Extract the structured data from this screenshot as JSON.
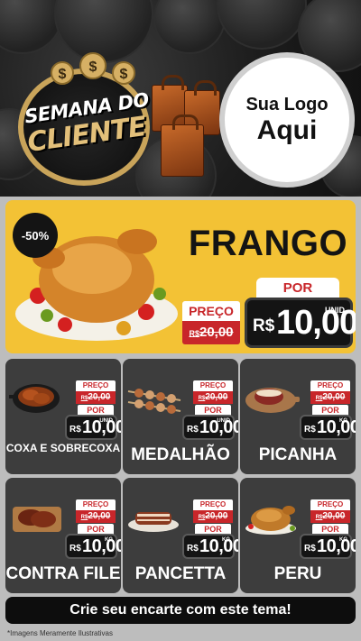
{
  "header": {
    "badge_line1": "SEMANA DO",
    "badge_line2": "CLIENTE",
    "logo_line1": "Sua Logo",
    "logo_line2": "Aqui"
  },
  "main_product": {
    "discount": "-50%",
    "name": "FRANGO",
    "price_label": "PREÇO",
    "old_currency": "R$",
    "old_price": "20,00",
    "por_label": "POR",
    "currency": "R$",
    "new_price": "10,00",
    "unit": "UNID",
    "image_icon": "roast-chicken-icon"
  },
  "products": [
    {
      "name": "COXA E SOBRECOXA",
      "price_label": "PREÇO",
      "old_currency": "R$",
      "old_price": "20,00",
      "por_label": "POR",
      "currency": "R$",
      "new_price": "10,00",
      "unit": "UNID",
      "image_icon": "chicken-thigh-pan-icon"
    },
    {
      "name": "MEDALHÃO",
      "price_label": "PREÇO",
      "old_currency": "R$",
      "old_price": "20,00",
      "por_label": "POR",
      "currency": "R$",
      "new_price": "10,00",
      "unit": "UNID",
      "image_icon": "skewers-icon"
    },
    {
      "name": "PICANHA",
      "price_label": "PREÇO",
      "old_currency": "R$",
      "old_price": "20,00",
      "por_label": "POR",
      "currency": "R$",
      "new_price": "10,00",
      "unit": "KG",
      "image_icon": "picanha-board-icon"
    },
    {
      "name": "CONTRA FILE",
      "price_label": "PREÇO",
      "old_currency": "R$",
      "old_price": "20,00",
      "por_label": "POR",
      "currency": "R$",
      "new_price": "10,00",
      "unit": "KG",
      "image_icon": "steak-board-icon"
    },
    {
      "name": "PANCETTA",
      "price_label": "PREÇO",
      "old_currency": "R$",
      "old_price": "20,00",
      "por_label": "POR",
      "currency": "R$",
      "new_price": "10,00",
      "unit": "KG",
      "image_icon": "pancetta-icon"
    },
    {
      "name": "PERU",
      "price_label": "PREÇO",
      "old_currency": "R$",
      "old_price": "20,00",
      "por_label": "POR",
      "currency": "R$",
      "new_price": "10,00",
      "unit": "KG",
      "image_icon": "roast-turkey-icon"
    }
  ],
  "cta": "Crie seu encarte com este tema!",
  "note": "*Imagens Meramente Ilustrativas",
  "colors": {
    "accent_yellow": "#f3c235",
    "price_red": "#c8262a",
    "card_gray": "#3d3d3d",
    "gold": "#c9a45a"
  }
}
